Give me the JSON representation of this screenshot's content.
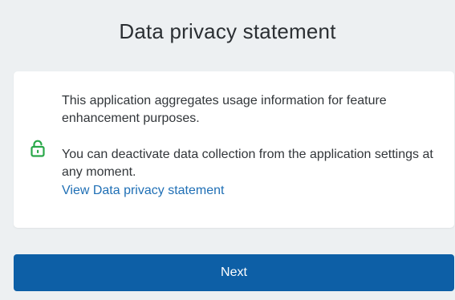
{
  "dialog": {
    "title": "Data privacy statement"
  },
  "card": {
    "paragraph_1": "This application aggregates usage information for feature enhancement purposes.",
    "paragraph_2": "You can deactivate data collection from the application settings at any moment.",
    "link_text": "View Data privacy statement",
    "lock_icon": "lock-icon"
  },
  "actions": {
    "next_label": "Next"
  },
  "colors": {
    "background": "#edf0f2",
    "card": "#ffffff",
    "lock_icon": "#2aa84a",
    "link": "#1f6fb5",
    "primary_button": "#0d5fa6"
  }
}
